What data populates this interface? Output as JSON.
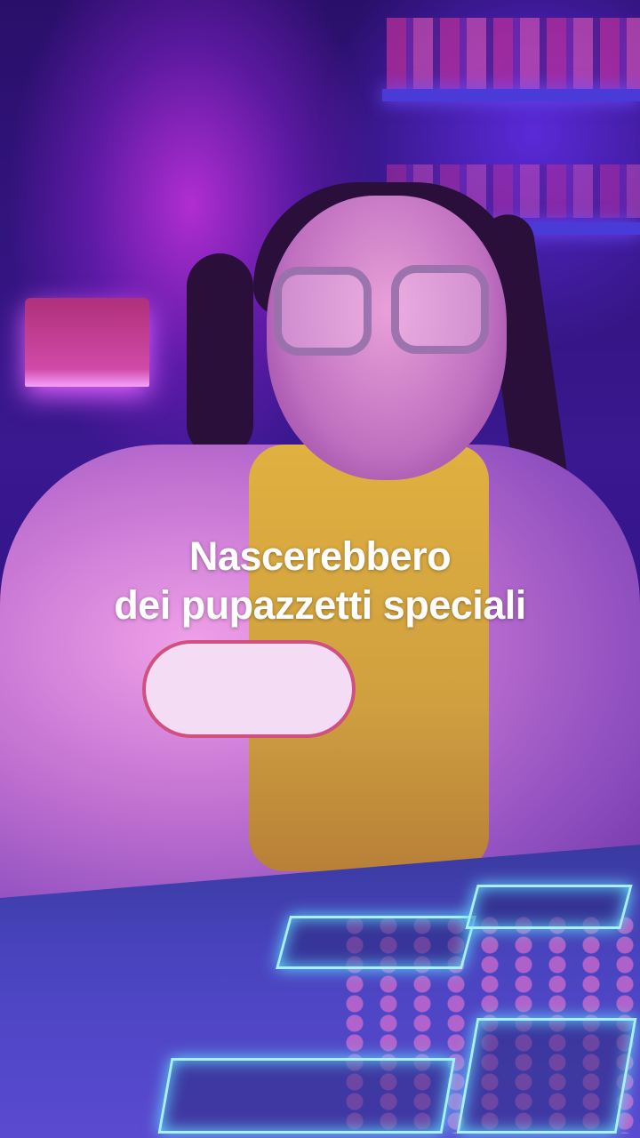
{
  "caption": {
    "line1": "Nascerebbero",
    "line2": "dei pupazzetti speciali",
    "color": "#ffffff"
  },
  "scene_colors": {
    "background": "#2a0f6a",
    "accent_glow": "#60d8ff",
    "lamp": "#d04aa8"
  }
}
